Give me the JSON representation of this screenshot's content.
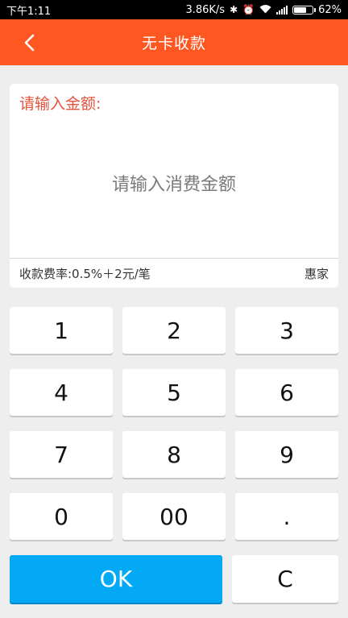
{
  "status_bar": {
    "time": "下午1:11",
    "net_speed": "3.86K/s",
    "battery": "62%"
  },
  "nav": {
    "title": "无卡收款",
    "back_icon": "chevron-left-icon"
  },
  "amount_card": {
    "label": "请输入金额:",
    "input_value": "",
    "input_placeholder": "请输入消费金额",
    "fee_text": "收款费率:0.5%＋2元/笔",
    "brand": "惠家"
  },
  "keypad": {
    "keys": [
      "1",
      "2",
      "3",
      "4",
      "5",
      "6",
      "7",
      "8",
      "9",
      "0",
      "00",
      "."
    ],
    "ok_label": "OK",
    "clear_label": "C"
  },
  "colors": {
    "nav_bg": "#ff5722",
    "label": "#e5533c",
    "ok_bg": "#03a9f4",
    "page_bg": "#eeeeee"
  }
}
